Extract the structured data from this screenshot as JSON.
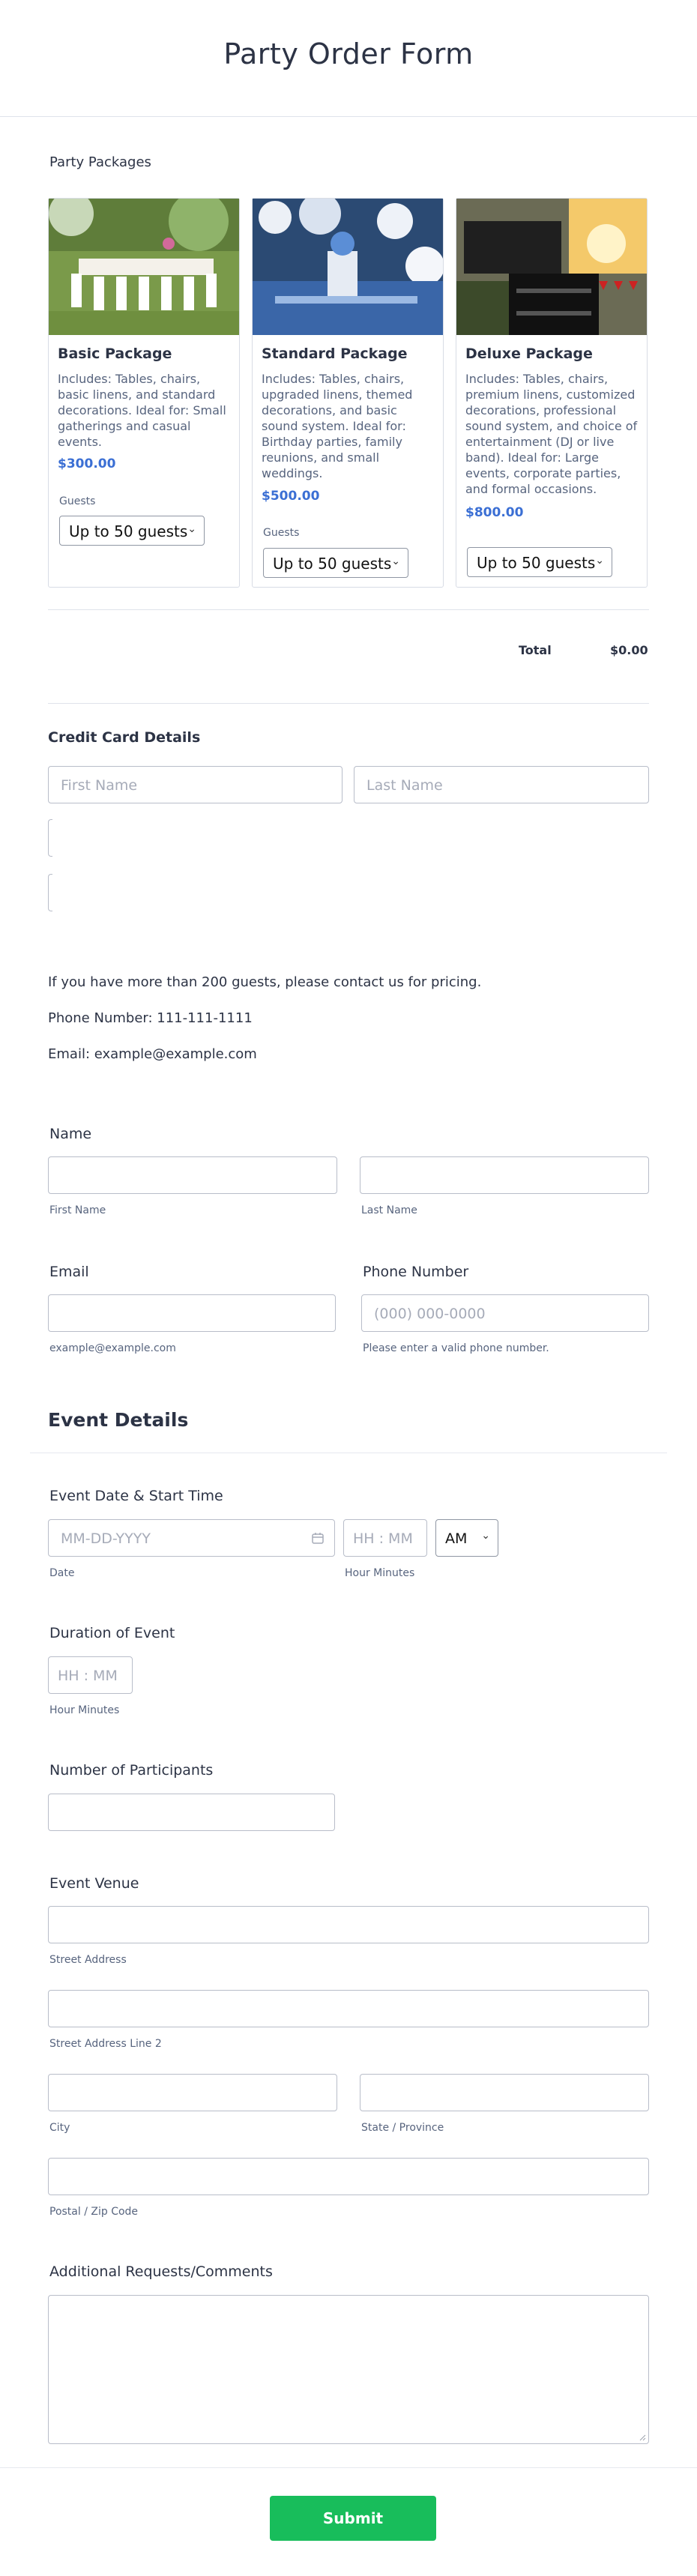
{
  "form_title": "Party Order Form",
  "packages": {
    "label": "Party Packages",
    "items": [
      {
        "name": "Basic Package",
        "desc": "Includes: Tables, chairs, basic linens, and standard decorations. Ideal for: Small gatherings and casual events.",
        "price": "$300.00",
        "guests_label": "Guests",
        "guests_value": "Up to 50 guests"
      },
      {
        "name": "Standard Package",
        "desc": "Includes: Tables, chairs, upgraded linens, themed decorations, and basic sound system. Ideal for: Birthday parties, family reunions, and small weddings.",
        "price": "$500.00",
        "guests_label": "Guests",
        "guests_value": "Up to 50 guests"
      },
      {
        "name": "Deluxe Package",
        "desc": "Includes: Tables, chairs, premium linens, customized decorations, professional sound system, and choice of entertainment (DJ or live band). Ideal for: Large events, corporate parties, and formal occasions.",
        "price": "$800.00",
        "guests_value": "Up to 50 guests"
      }
    ],
    "total_label": "Total",
    "total_value": "$0.00"
  },
  "credit_card": {
    "heading": "Credit Card Details",
    "first_name_placeholder": "First Name",
    "last_name_placeholder": "Last Name"
  },
  "info": {
    "line1": "If you have more than 200 guests, please contact us for pricing.",
    "line2": "Phone Number: 111-111-1111",
    "line3": "Email: example@example.com"
  },
  "name": {
    "label": "Name",
    "first_sub": "First Name",
    "last_sub": "Last Name"
  },
  "email": {
    "label": "Email",
    "sub": "example@example.com"
  },
  "phone": {
    "label": "Phone Number",
    "placeholder": "(000) 000-0000",
    "sub": "Please enter a valid phone number."
  },
  "event_details_heading": "Event Details",
  "event_date": {
    "label": "Event Date & Start Time",
    "date_placeholder": "MM-DD-YYYY",
    "time_placeholder": "HH : MM",
    "ampm": "AM",
    "date_sub": "Date",
    "time_sub": "Hour Minutes"
  },
  "duration": {
    "label": "Duration of Event",
    "placeholder": "HH : MM",
    "sub": "Hour Minutes"
  },
  "participants": {
    "label": "Number of Participants"
  },
  "venue": {
    "label": "Event Venue",
    "street_sub": "Street Address",
    "street2_sub": "Street Address Line 2",
    "city_sub": "City",
    "state_sub": "State / Province",
    "zip_sub": "Postal / Zip Code"
  },
  "comments": {
    "label": "Additional Requests/Comments"
  },
  "submit_label": "Submit",
  "colors": {
    "accent": "#18bd5b",
    "price": "#3b6fd4",
    "border": "#b8bdc9"
  }
}
